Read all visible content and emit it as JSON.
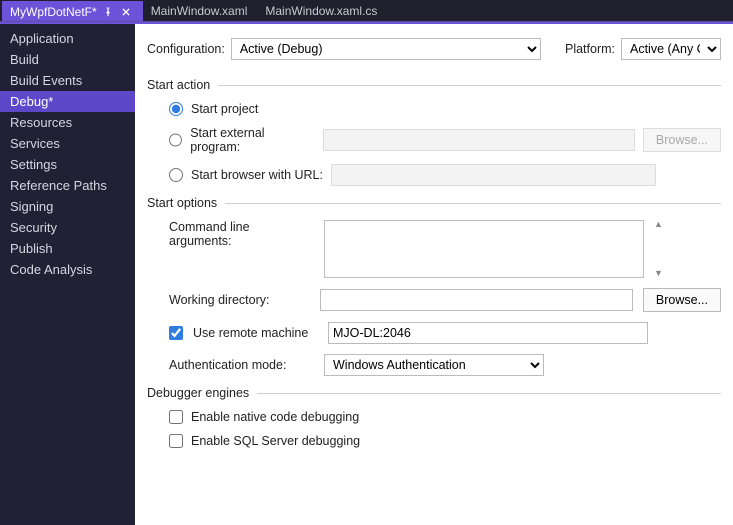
{
  "tabs": {
    "active": {
      "label": "MyWpfDotNetF*"
    },
    "others": [
      "MainWindow.xaml",
      "MainWindow.xaml.cs"
    ]
  },
  "sidebar": {
    "items": [
      "Application",
      "Build",
      "Build Events",
      "Debug*",
      "Resources",
      "Services",
      "Settings",
      "Reference Paths",
      "Signing",
      "Security",
      "Publish",
      "Code Analysis"
    ],
    "selected_index": 3
  },
  "config": {
    "configuration_label": "Configuration:",
    "configuration_value": "Active (Debug)",
    "platform_label": "Platform:",
    "platform_value": "Active (Any CPU)"
  },
  "sections": {
    "start_action": {
      "title": "Start action",
      "start_project": "Start project",
      "start_external": "Start external program:",
      "browse": "Browse...",
      "start_browser": "Start browser with URL:",
      "external_value": "",
      "url_value": ""
    },
    "start_options": {
      "title": "Start options",
      "cmd_args_label": "Command line arguments:",
      "cmd_args_value": "",
      "working_dir_label": "Working directory:",
      "working_dir_value": "",
      "working_dir_browse": "Browse...",
      "remote_label": "Use remote machine",
      "remote_checked": true,
      "remote_value": "MJO-DL:2046",
      "auth_label": "Authentication mode:",
      "auth_value": "Windows Authentication"
    },
    "debugger_engines": {
      "title": "Debugger engines",
      "native": "Enable native code debugging",
      "sql": "Enable SQL Server debugging"
    }
  }
}
